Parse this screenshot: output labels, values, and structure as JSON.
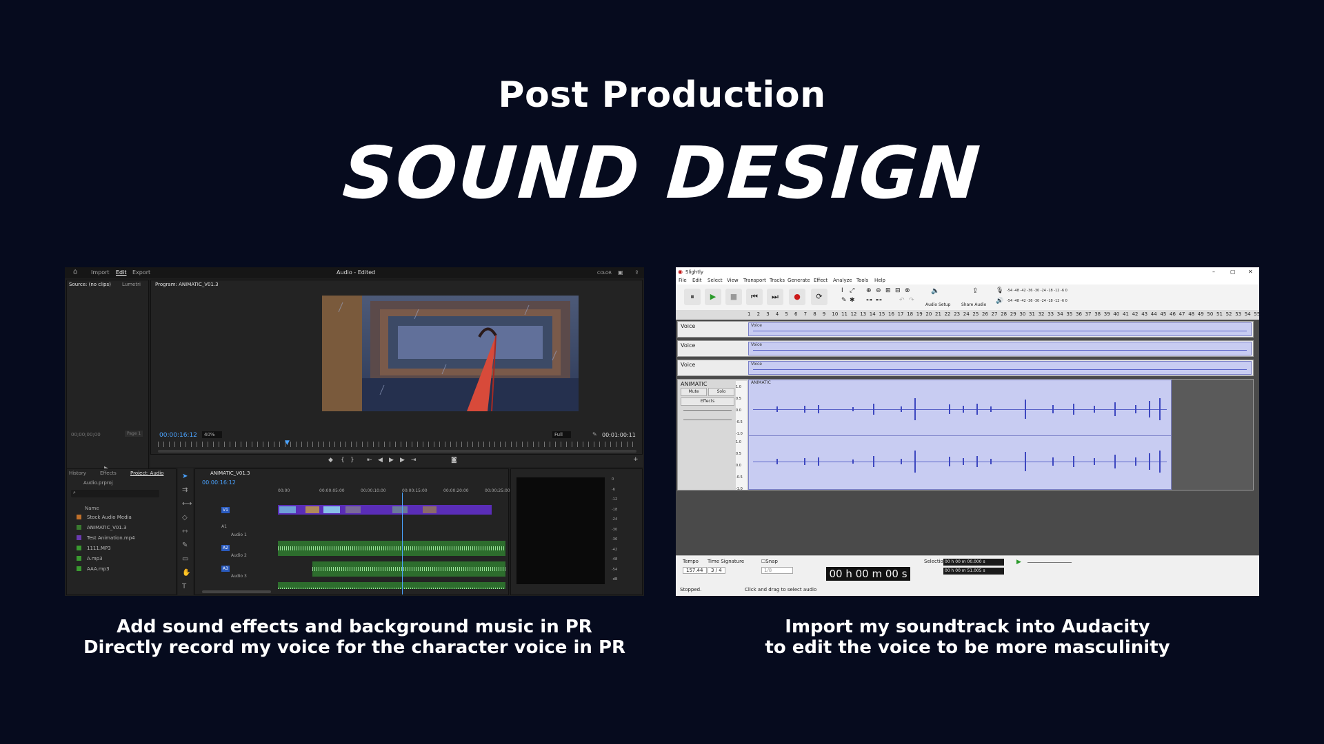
{
  "slide": {
    "subtitle": "Post Production",
    "title": "SOUND DESIGN",
    "caption_left": [
      "Add sound effects and background music in PR",
      "Directly record my voice for the character voice in PR"
    ],
    "caption_right": [
      "Import my soundtrack into Audacity",
      "to edit the voice to be more masculinity"
    ]
  },
  "premiere": {
    "top_tabs": [
      "Import",
      "Edit",
      "Export"
    ],
    "window_title": "Audio - Edited",
    "color_label": "COLOR",
    "source_tab": "Source: (no clips)",
    "lumetri_tab": "Lumetri",
    "program_tab": "Program: ANIMATIC_V01.3",
    "source_timecode": "00;00;00;00",
    "page_label": "Page 1",
    "program_timecode": "00:00:16:12",
    "zoom": "40%",
    "quality": "Full",
    "duration": "00:01:00:11",
    "project_tabs": [
      "History",
      "Effects",
      "Project: Audio"
    ],
    "project_file": "Audio.prproj",
    "name_header": "Name",
    "project_items": [
      {
        "name": "Stock Audio Media",
        "color": "#c0702a"
      },
      {
        "name": "ANIMATIC_V01.3",
        "color": "#3a7a30"
      },
      {
        "name": "Test Animation.mp4",
        "color": "#6a3ab0"
      },
      {
        "name": "1111.MP3",
        "color": "#3a9a30"
      },
      {
        "name": "A.mp3",
        "color": "#3a9a30"
      },
      {
        "name": "AAA.mp3",
        "color": "#3a9a30"
      }
    ],
    "sequence_tab": "ANIMATIC_V01.3",
    "sequence_timecode": "00:00:16:12",
    "ruler_labels": [
      "00:00",
      "00:00:05:00",
      "00:00:10:00",
      "00:00:15:00",
      "00:00:20:00",
      "00:00:25:00"
    ],
    "tracks": [
      "V1",
      "A1",
      "A2",
      "A3"
    ],
    "track_names": [
      "Audio 1",
      "Audio 2",
      "Audio 3"
    ],
    "meter_labels": [
      "0",
      "-6",
      "-12",
      "-18",
      "-24",
      "-30",
      "-36",
      "-42",
      "-48",
      "-54",
      "-dB"
    ],
    "colors": {
      "accent": "#4aa3ff",
      "video_clip": "#5a2db8",
      "audio_clip": "#2d6d2d"
    }
  },
  "audacity": {
    "window_title": "Slightly",
    "menu": [
      "File",
      "Edit",
      "Select",
      "View",
      "Transport",
      "Tracks",
      "Generate",
      "Effect",
      "Analyze",
      "Tools",
      "Help"
    ],
    "audio_setup": "Audio Setup",
    "share_audio": "Share Audio",
    "meter_scale": "-54 -48 -42 -36 -30 -24 -18 -12 -6 0",
    "timeline": [
      "1",
      "2",
      "3",
      "4",
      "5",
      "6",
      "7",
      "8",
      "9",
      "10",
      "11",
      "12",
      "13",
      "14",
      "15",
      "16",
      "17",
      "18",
      "19",
      "20",
      "21",
      "22",
      "23",
      "24",
      "25",
      "26",
      "27",
      "28",
      "29",
      "30",
      "31",
      "32",
      "33",
      "34",
      "35",
      "36",
      "37",
      "38",
      "39",
      "40",
      "41",
      "42",
      "43",
      "44",
      "45",
      "46",
      "47",
      "48",
      "49",
      "50",
      "51",
      "52",
      "53",
      "54",
      "55"
    ],
    "voice_tracks": [
      "Voice",
      "Voice",
      "Voice"
    ],
    "main_track": "ANIMATIC",
    "mute": "Mute",
    "solo": "Solo",
    "effects": "Effects",
    "scale": [
      "1.0",
      "0.5",
      "0.0",
      "-0.5",
      "-1.0"
    ],
    "tempo_label": "Tempo",
    "tempo_value": "157.44",
    "time_sig_label": "Time Signature",
    "time_sig": "3 / 4",
    "snap_label": "Snap",
    "snap_value": "1/8",
    "clock": "00 h 00 m 00 s",
    "selection_label": "Selection",
    "selection_start": "00 h 00 m 00.000 s",
    "selection_end": "00 h 00 m 51.005 s",
    "status_left": "Stopped.",
    "status_right": "Click and drag to select audio",
    "colors": {
      "waveform": "#3d47c0",
      "clip": "#c8ccf2"
    }
  }
}
